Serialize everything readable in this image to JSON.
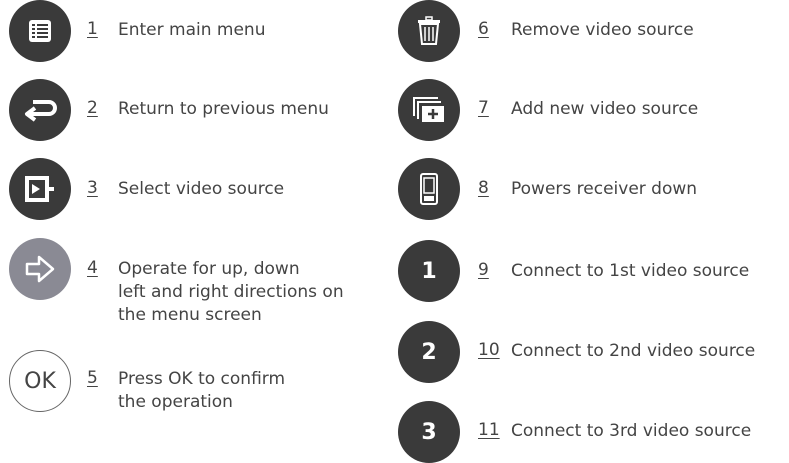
{
  "legend": [
    {
      "number": "1",
      "text": "Enter main menu",
      "icon": "menu-list-icon"
    },
    {
      "number": "2",
      "text": "Return to previous menu",
      "icon": "return-arrow-icon"
    },
    {
      "number": "3",
      "text": "Select video source",
      "icon": "source-select-icon"
    },
    {
      "number": "4",
      "lines": [
        "Operate for up, down",
        "left and right directions on",
        "the menu screen"
      ],
      "icon": "direction-arrow-icon"
    },
    {
      "number": "5",
      "lines": [
        "Press OK to confirm",
        "the operation"
      ],
      "icon": "ok-icon",
      "glyph": "OK"
    },
    {
      "number": "6",
      "text": "Remove video source",
      "icon": "trash-icon"
    },
    {
      "number": "7",
      "text": "Add new video source",
      "icon": "add-source-icon"
    },
    {
      "number": "8",
      "text": "Powers receiver down",
      "icon": "receiver-power-icon"
    },
    {
      "number": "9",
      "text": "Connect to 1st video source",
      "icon": "source-1-icon",
      "glyph": "1"
    },
    {
      "number": "10",
      "text": "Connect to 2nd video source",
      "icon": "source-2-icon",
      "glyph": "2"
    },
    {
      "number": "11",
      "text": "Connect to 3rd video source",
      "icon": "source-3-icon",
      "glyph": "3"
    }
  ],
  "colors": {
    "icon_dark": "#3a3a3a",
    "icon_gray": "#8a8a94",
    "text": "#444444"
  }
}
